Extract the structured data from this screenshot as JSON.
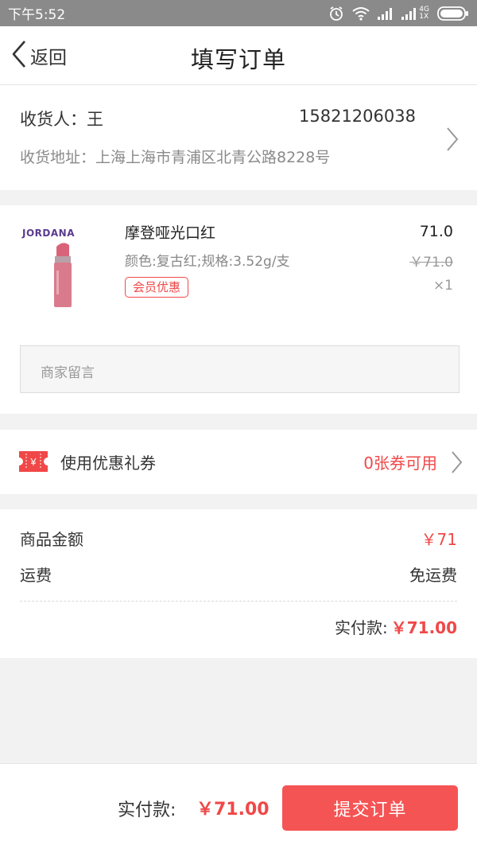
{
  "status_bar": {
    "time": "下午5:52",
    "network_top": "4G",
    "network_bottom": "1X"
  },
  "nav": {
    "back_label": "返回",
    "title": "填写订单"
  },
  "address": {
    "receiver": "收货人：王",
    "phone": "15821206038",
    "address_line": "收货地址：上海上海市青浦区北青公路8228号"
  },
  "product": {
    "brand_logo": "JORDANA",
    "name": "摩登哑光口红",
    "spec": "颜色:复古红;规格:3.52g/支",
    "badge": "会员优惠",
    "price": "71.0",
    "original_price": "￥71.0",
    "quantity": "×1",
    "note_placeholder": "商家留言"
  },
  "coupon": {
    "icon_text": "¥",
    "label": "使用优惠礼券",
    "value": "0张券可用"
  },
  "summary": {
    "goods_label": "商品金额",
    "goods_value": "￥71",
    "shipping_label": "运费",
    "shipping_value": "免运费",
    "paid_label": "实付款:",
    "paid_value": "￥71.00"
  },
  "bottom": {
    "paid_label": "实付款:",
    "paid_value": "￥71.00",
    "submit_label": "提交订单"
  },
  "colors": {
    "accent": "#f55454",
    "price_red": "#f04848",
    "statusbar": "#8a8a8a"
  }
}
